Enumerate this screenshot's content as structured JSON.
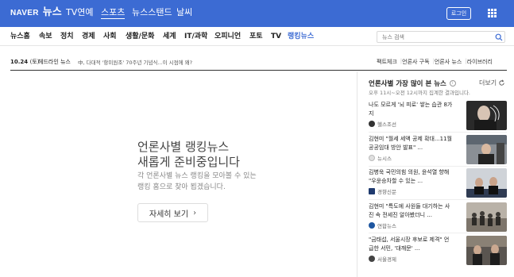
{
  "header": {
    "logo_naver": "NAVER",
    "logo_news": "뉴스",
    "services": [
      "TV연예",
      "스포츠",
      "뉴스스탠드",
      "날씨"
    ],
    "login_label": "로그인",
    "grid_icon": "apps-grid-icon",
    "brand_color": "#3c6bd3"
  },
  "nav": {
    "categories": [
      "뉴스홈",
      "속보",
      "정치",
      "경제",
      "사회",
      "생활/문화",
      "세계",
      "IT/과학",
      "오피니언",
      "포토",
      "TV",
      "랭킹뉴스"
    ],
    "active": "랭킹뉴스",
    "search_placeholder": "뉴스 검색"
  },
  "headline": {
    "date": "10.24",
    "day": "(토)",
    "label": "헤드라인 뉴스",
    "text": "中, 다대적 '항미원조' 70주년 기념식...이 시점에 왜?",
    "links": [
      "팩트체크",
      "언론사 구독",
      "언론사 뉴스",
      "라이브러리"
    ]
  },
  "placeholder": {
    "title_line1": "언론사별 랭킹뉴스",
    "title_line2": "새롭게 준비중입니다",
    "desc_line1": "각 언론사별 뉴스 랭킹을 모아볼 수 있는",
    "desc_line2": "랭킹 홈으로 찾아 뵙겠습니다.",
    "button_label": "자세히 보기",
    "button_chevron": "›"
  },
  "ranking": {
    "title": "언론사별 가장 많이 본 뉴스",
    "info": "i",
    "more_label": "더보기",
    "subtitle": "오후 11시~오전 12시까지 집계한 결과입니다.",
    "items": [
      {
        "line1": "나도 모르게 '뇌 피로' 쌓는 습관 8가",
        "line2": "지",
        "press": "헬스조선",
        "press_color": "#333333"
      },
      {
        "line1": "김현미 \"월세 세액 공제 확대...11월",
        "line2": "공공임대 방안 발표\" ...",
        "press": "뉴시스",
        "press_color": "#e8e8e8"
      },
      {
        "line1": "김병욱 국민의힘 의원, 윤석열 향해",
        "line2": "\"우윤승차할 수 있는 ...",
        "press": "경향신문",
        "press_color": "#1f3a6e"
      },
      {
        "line1": "김현미 \"특도에 사원들 대기하는 사",
        "line2": "진 속 전세진 알아봤더니 ...",
        "press": "연합뉴스",
        "press_color": "#1e56a0"
      },
      {
        "line1": "\"금태섭, 서울시장 후보로 제격\" 언",
        "line2": "급한 서민, '대깨문' ...",
        "press": "서울경제",
        "press_color": "#444444"
      }
    ]
  }
}
